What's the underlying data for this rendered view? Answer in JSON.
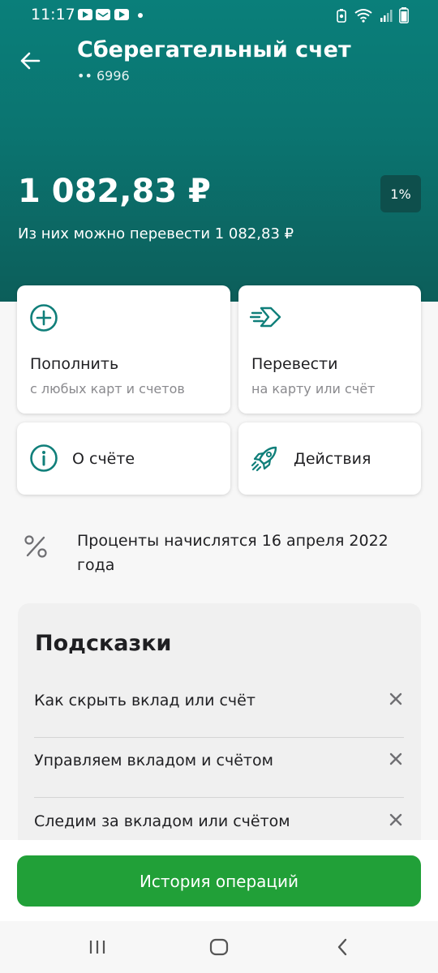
{
  "status_bar": {
    "time": "11:17"
  },
  "header": {
    "title": "Сберегательный счет",
    "account_number": "•• 6996"
  },
  "balance": {
    "amount": "1 082,83 ₽",
    "rate": "1%",
    "available_text": "Из них можно перевести 1 082,83 ₽"
  },
  "actions": [
    {
      "title": "Пополнить",
      "subtitle": "с любых карт и счетов",
      "icon": "plus-circle-icon"
    },
    {
      "title": "Перевести",
      "subtitle": "на карту или счёт",
      "icon": "arrow-transfer-icon"
    },
    {
      "title": "О счёте",
      "icon": "info-icon"
    },
    {
      "title": "Действия",
      "icon": "rocket-icon"
    }
  ],
  "interest": {
    "text": "Проценты начислятся 16 апреля 2022 года",
    "icon": "percent-icon"
  },
  "tips": {
    "title": "Подсказки",
    "items": [
      {
        "label": "Как скрыть вклад или счёт"
      },
      {
        "label": "Управляем вкладом и счётом"
      },
      {
        "label": "Следим за вкладом или счётом"
      }
    ]
  },
  "footer": {
    "history_button": "История операций"
  },
  "colors": {
    "brand_teal": "#0a7f7a",
    "brand_green": "#21a038",
    "icon_teal": "#107f7a"
  }
}
